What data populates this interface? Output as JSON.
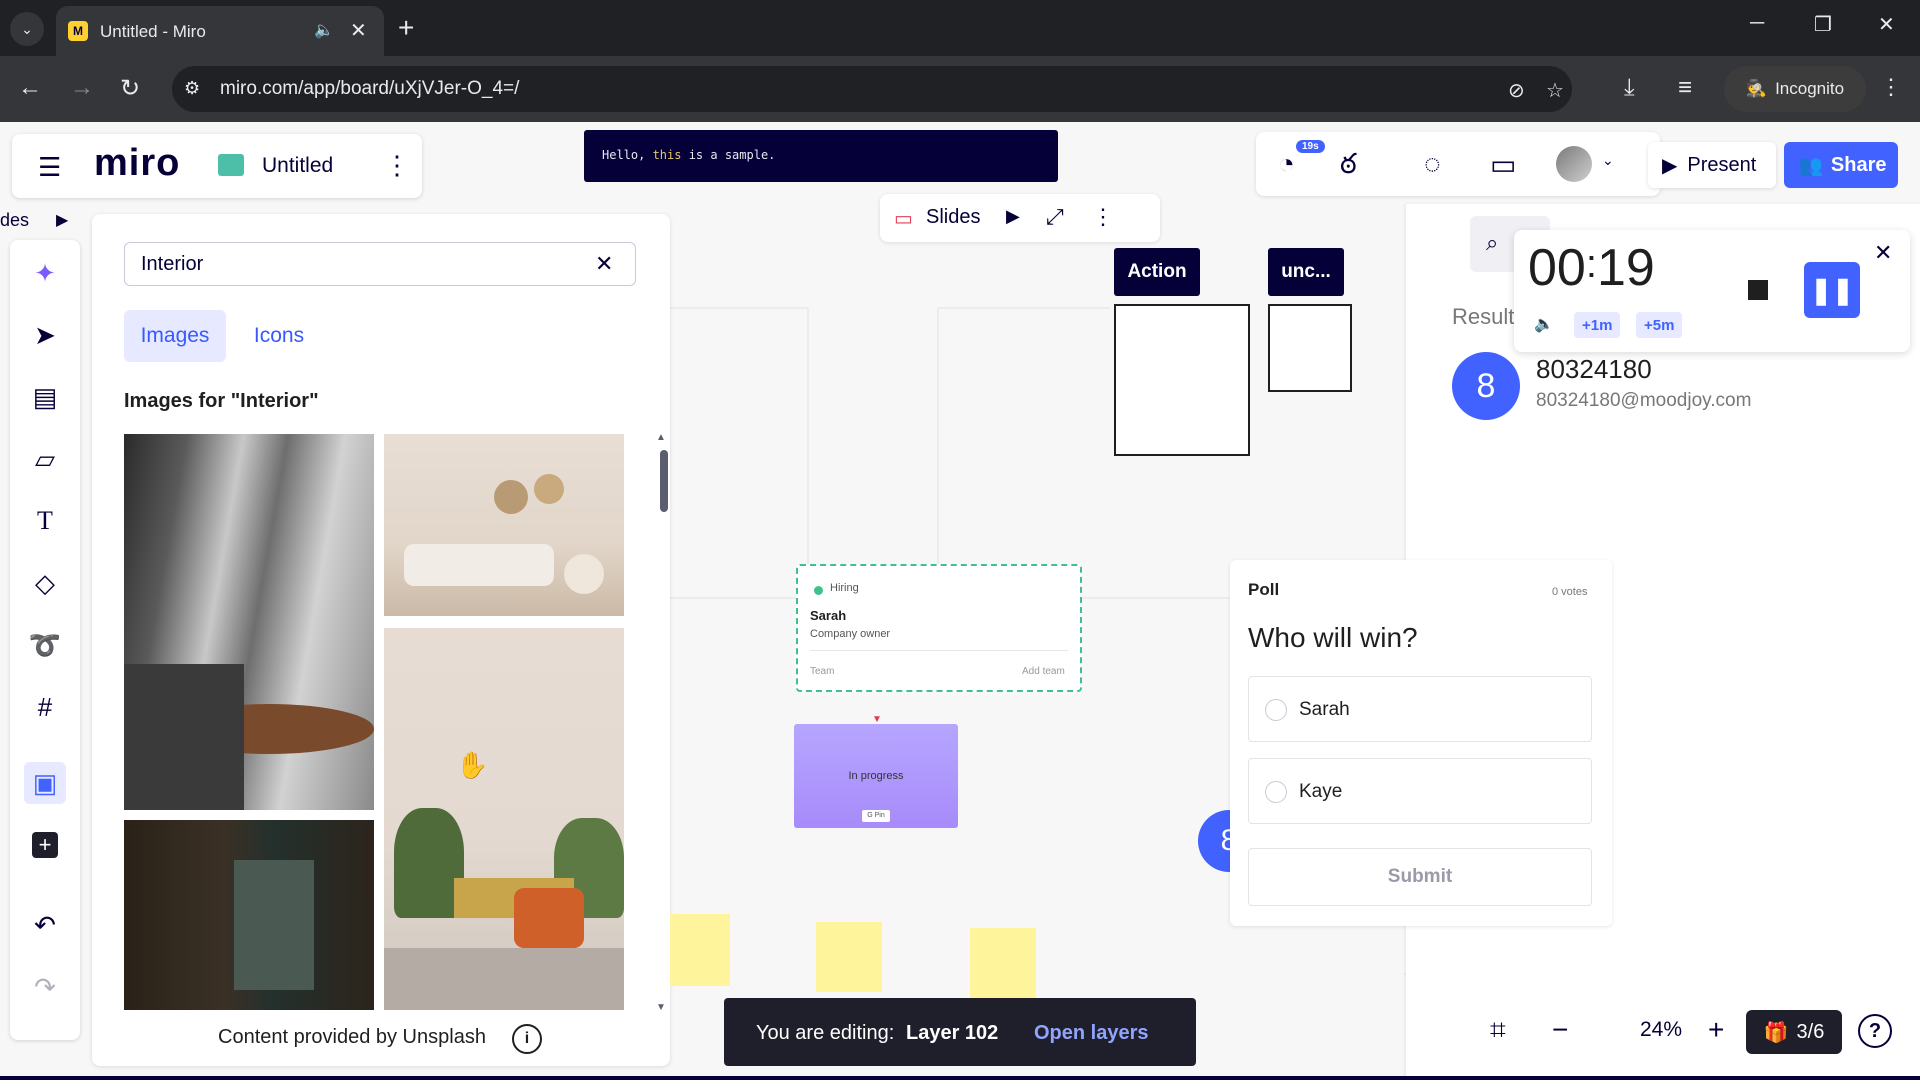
{
  "browser": {
    "tab_title": "Untitled - Miro",
    "favicon_letter": "M",
    "url": "miro.com/app/board/uXjVJer-O_4=/",
    "incognito_label": "Incognito"
  },
  "board": {
    "logo": "miro",
    "title": "Untitled",
    "slides_strip_label": "des"
  },
  "sample_banner": {
    "text_before": "Hello, ",
    "text_keyword": "this",
    "text_after": " is a sample."
  },
  "slides_bar": {
    "label": "Slides"
  },
  "left_toolbar": {
    "tools": [
      "ai-sparkle-icon",
      "select-arrow-icon",
      "templates-icon",
      "sticky-note-icon",
      "text-icon",
      "shapes-icon",
      "lasso-icon",
      "frame-icon",
      "image-search-icon",
      "add-more-icon",
      "undo-icon",
      "redo-icon"
    ]
  },
  "image_panel": {
    "search_value": "Interior",
    "tab_images": "Images",
    "tab_icons": "Icons",
    "results_heading": "Images for \"Interior\"",
    "credit": "Content provided by Unsplash"
  },
  "canvas": {
    "label_action": "Action",
    "label_unc": "unc...",
    "hiring_card": {
      "status": "Hiring",
      "name": "Sarah",
      "role": "Company owner",
      "team": "Team",
      "add_team": "Add team"
    },
    "progress_card": {
      "label": "In progress",
      "chip": "G Pin"
    },
    "avatar_letter": "8"
  },
  "poll": {
    "label": "Poll",
    "votes": "0 votes",
    "question": "Who will win?",
    "options": [
      "Sarah",
      "Kaye"
    ],
    "submit": "Submit"
  },
  "collab": {
    "timer_badge": "19s",
    "present_label": "Present",
    "share_label": "Share"
  },
  "right_panel": {
    "result_label": "Result",
    "avatar_letter": "8",
    "name": "80324180",
    "email": "80324180@moodjoy.com"
  },
  "timer": {
    "minutes": "00",
    "seconds": "19",
    "add_1m": "+1m",
    "add_5m": "+5m"
  },
  "edit_toast": {
    "prefix": "You are editing:",
    "layer": "Layer 102",
    "action": "Open layers"
  },
  "zoom": {
    "level": "24%",
    "slide_count": "3/6"
  },
  "colors": {
    "accent": "#4262ff",
    "miro_navy": "#050038",
    "sticky": "#fef49c",
    "hiring_green": "#40c08a"
  }
}
